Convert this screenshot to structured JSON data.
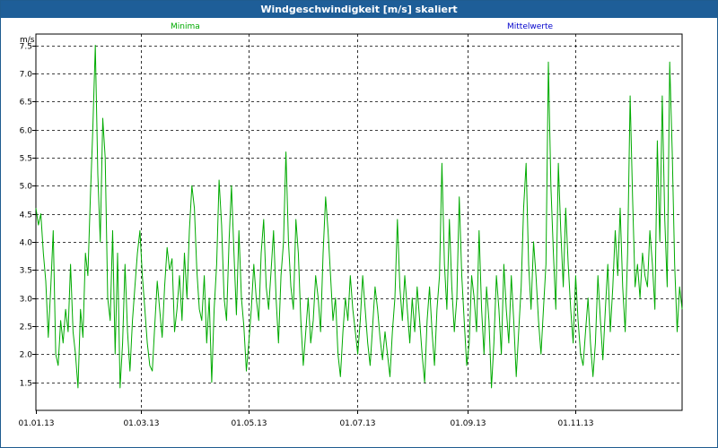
{
  "window": {
    "title": "Windgeschwindigkeit [m/s] skaliert"
  },
  "legend": {
    "min_label": "Minima",
    "mean_label": "Mittelwerte",
    "min_color": "#00aa00",
    "mean_color": "#0000cc"
  },
  "chart_data": {
    "type": "line",
    "title": "Windgeschwindigkeit [m/s] skaliert",
    "ylabel": "m/s",
    "ylim": [
      1.0,
      7.7
    ],
    "xlim": [
      "01.01.13",
      "31.12.13"
    ],
    "grid": true,
    "y_ticks": [
      "1.5",
      "2.0",
      "2.5",
      "3.0",
      "3.5",
      "4.0",
      "4.5",
      "5.0",
      "5.5",
      "6.0",
      "6.5",
      "7.0",
      "7.5"
    ],
    "x_ticks": [
      "01.01.13",
      "01.03.13",
      "01.05.13",
      "01.07.13",
      "01.09.13",
      "01.11.13"
    ],
    "series": [
      {
        "name": "Minima",
        "color": "#00aa00",
        "values": [
          4.6,
          4.3,
          4.5,
          3.8,
          3.3,
          2.3,
          3.2,
          4.2,
          2.0,
          1.8,
          2.6,
          2.2,
          2.8,
          2.4,
          3.6,
          2.4,
          2.0,
          1.4,
          2.8,
          2.3,
          3.8,
          3.4,
          4.8,
          6.0,
          7.5,
          5.2,
          4.0,
          6.2,
          5.5,
          3.0,
          2.6,
          4.2,
          2.0,
          3.8,
          1.4,
          2.2,
          3.6,
          2.4,
          1.7,
          2.6,
          3.2,
          3.8,
          4.2,
          3.4,
          2.8,
          2.2,
          1.8,
          1.7,
          2.5,
          3.3,
          2.8,
          2.3,
          3.2,
          3.9,
          3.5,
          3.7,
          2.4,
          2.8,
          3.4,
          2.6,
          3.8,
          3.0,
          4.2,
          5.0,
          4.6,
          3.5,
          2.8,
          2.6,
          3.4,
          2.2,
          3.0,
          1.5,
          2.8,
          3.6,
          5.1,
          4.3,
          3.0,
          2.6,
          4.0,
          5.0,
          3.8,
          2.7,
          4.2,
          3.0,
          2.5,
          1.7,
          2.2,
          2.8,
          3.6,
          3.0,
          2.6,
          3.8,
          4.4,
          3.2,
          2.8,
          3.5,
          4.2,
          3.0,
          2.2,
          3.4,
          4.0,
          5.6,
          4.0,
          3.2,
          2.8,
          4.4,
          3.8,
          2.6,
          1.8,
          2.4,
          3.0,
          2.2,
          2.6,
          3.4,
          3.0,
          2.4,
          3.8,
          4.8,
          4.2,
          3.4,
          2.6,
          3.0,
          2.0,
          1.6,
          2.4,
          3.0,
          2.6,
          3.4,
          2.8,
          2.4,
          2.0,
          2.6,
          3.4,
          2.8,
          2.2,
          1.8,
          2.5,
          3.2,
          2.8,
          2.3,
          1.9,
          2.4,
          2.0,
          1.6,
          2.4,
          3.0,
          4.4,
          3.2,
          2.6,
          3.4,
          2.8,
          2.2,
          3.0,
          2.4,
          3.2,
          2.6,
          2.0,
          1.5,
          2.6,
          3.2,
          2.4,
          1.8,
          2.8,
          3.4,
          5.4,
          3.6,
          2.8,
          4.4,
          3.2,
          2.4,
          3.0,
          4.8,
          3.4,
          2.6,
          1.8,
          2.2,
          3.4,
          3.0,
          2.4,
          4.2,
          2.8,
          2.0,
          3.2,
          2.6,
          1.4,
          2.2,
          3.4,
          2.8,
          2.0,
          3.6,
          2.8,
          2.2,
          3.4,
          2.6,
          1.6,
          2.4,
          3.2,
          4.6,
          5.4,
          3.6,
          2.8,
          4.0,
          3.4,
          2.6,
          2.0,
          2.8,
          3.6,
          7.2,
          5.0,
          3.8,
          2.8,
          5.4,
          4.2,
          3.2,
          4.6,
          3.6,
          2.8,
          2.2,
          3.4,
          2.6,
          2.0,
          1.8,
          2.4,
          3.0,
          2.2,
          1.6,
          2.2,
          3.4,
          2.6,
          1.9,
          2.8,
          3.6,
          2.4,
          3.2,
          4.2,
          3.4,
          4.6,
          3.2,
          2.4,
          3.8,
          6.6,
          4.8,
          3.2,
          3.6,
          3.0,
          3.8,
          3.4,
          3.2,
          4.2,
          3.6,
          2.8,
          5.8,
          4.0,
          6.6,
          4.4,
          3.2,
          7.2,
          5.6,
          3.6,
          2.4,
          3.2,
          2.8
        ]
      }
    ]
  }
}
